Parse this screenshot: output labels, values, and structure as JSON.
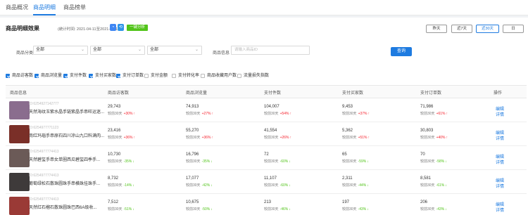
{
  "tabs": [
    {
      "label": "商品概况"
    },
    {
      "label": "商品明细"
    },
    {
      "label": "商品榜单"
    }
  ],
  "header": {
    "title": "商品明细效果",
    "stat_time": "(统计时间: 2021-04-11至2021-05-10)",
    "analyze_label": "一键分析",
    "date_buttons": [
      "昨天",
      "近7天",
      "近30天",
      "日"
    ],
    "active_date": "近30天"
  },
  "filters": {
    "category_label": "商品分类",
    "selects": [
      "全部",
      "全部",
      "全部"
    ],
    "info_label": "商品信息",
    "info_placeholder": "请输入商品ID",
    "query_label": "查询"
  },
  "metrics": [
    {
      "label": "商品访客数",
      "checked": true
    },
    {
      "label": "商品浏览量",
      "checked": true
    },
    {
      "label": "支付件数",
      "checked": true
    },
    {
      "label": "支付买家数",
      "checked": true
    },
    {
      "label": "支付订单数",
      "checked": true
    },
    {
      "label": "支付金额",
      "checked": false
    },
    {
      "label": "支付转化率",
      "checked": false
    },
    {
      "label": "商品收藏用户数",
      "checked": false
    },
    {
      "label": "流量损失指数",
      "checked": false
    }
  ],
  "table": {
    "headers": [
      "商品信息",
      "商品访客数",
      "商品浏览量",
      "支付件数",
      "支付买家数",
      "支付订单数",
      "操作"
    ],
    "rows": [
      {
        "id": "ID:6254927142777",
        "name": "天然海纹玉紫水晶手链紫晶手串旺运迷...",
        "cells": [
          {
            "value": "29,743",
            "cmp": "较前30天",
            "pct": "+30%",
            "dir": "up"
          },
          {
            "value": "74,913",
            "cmp": "较前30天",
            "pct": "+27%",
            "dir": "up"
          },
          {
            "value": "104,007",
            "cmp": "较前30天",
            "pct": "+54%",
            "dir": "up"
          },
          {
            "value": "9,453",
            "cmp": "较前30天",
            "pct": "+37%",
            "dir": "up"
          },
          {
            "value": "71,986",
            "cmp": "较前30天",
            "pct": "+61%",
            "dir": "up"
          }
        ],
        "ops": [
          "编辑",
          "详情"
        ]
      },
      {
        "id": "ID:6254977771123",
        "name": "南红玛瑙手串原石四川凉山九口料满肉...",
        "cells": [
          {
            "value": "23,416",
            "cmp": "较前30天",
            "pct": "+36%",
            "dir": "up"
          },
          {
            "value": "55,270",
            "cmp": "较前30天",
            "pct": "+36%",
            "dir": "up"
          },
          {
            "value": "41,554",
            "cmp": "较前30天",
            "pct": "+26%",
            "dir": "up"
          },
          {
            "value": "5,362",
            "cmp": "较前30天",
            "pct": "+51%",
            "dir": "up"
          },
          {
            "value": "30,803",
            "cmp": "较前30天",
            "pct": "+40%",
            "dir": "up"
          }
        ],
        "ops": [
          "编辑",
          "详情"
        ]
      },
      {
        "id": "ID:6254977774413",
        "name": "天然碧玺手串女单圈西瓜碧玺四季手...",
        "cells": [
          {
            "value": "10,730",
            "cmp": "较前30天",
            "pct": "-35%",
            "dir": "down"
          },
          {
            "value": "16,796",
            "cmp": "较前30天",
            "pct": "-35%",
            "dir": "down"
          },
          {
            "value": "72",
            "cmp": "较前30天",
            "pct": "-60%",
            "dir": "down"
          },
          {
            "value": "65",
            "cmp": "较前30天",
            "pct": "-59%",
            "dir": "down"
          },
          {
            "value": "70",
            "cmp": "较前30天",
            "pct": "-58%",
            "dir": "down"
          }
        ],
        "ops": [
          "编辑",
          "详情"
        ]
      },
      {
        "id": "ID:6254977774413",
        "name": "葡萄绿松石散珠圆珠手串横珠挂珠手...",
        "cells": [
          {
            "value": "8,732",
            "cmp": "较前30天",
            "pct": "-14%",
            "dir": "down"
          },
          {
            "value": "17,077",
            "cmp": "较前30天",
            "pct": "-42%",
            "dir": "down"
          },
          {
            "value": "11,107",
            "cmp": "较前30天",
            "pct": "-60%",
            "dir": "down"
          },
          {
            "value": "2,311",
            "cmp": "较前30天",
            "pct": "-44%",
            "dir": "down"
          },
          {
            "value": "8,581",
            "cmp": "较前30天",
            "pct": "-61%",
            "dir": "down"
          }
        ],
        "ops": [
          "编辑",
          "详情"
        ]
      },
      {
        "id": "ID:6254977774413",
        "name": "天然红石榴石散珠圆珠巴西6A级收...",
        "cells": [
          {
            "value": "7,512",
            "cmp": "较前30天",
            "pct": "-51%",
            "dir": "down"
          },
          {
            "value": "10,675",
            "cmp": "较前30天",
            "pct": "-50%",
            "dir": "down"
          },
          {
            "value": "213",
            "cmp": "较前30天",
            "pct": "-46%",
            "dir": "down"
          },
          {
            "value": "197",
            "cmp": "较前30天",
            "pct": "-43%",
            "dir": "down"
          },
          {
            "value": "206",
            "cmp": "较前30天",
            "pct": "-43%",
            "dir": "down"
          }
        ],
        "ops": [
          "编辑",
          "详情"
        ]
      }
    ]
  },
  "colors": {
    "accent": "#1e7be0",
    "up": "#f5222d",
    "down": "#52c41a",
    "thumbs": [
      "#8a6d8e",
      "#7a2f28",
      "#6b5a57",
      "#3e3a3a",
      "#9a3a36"
    ]
  }
}
